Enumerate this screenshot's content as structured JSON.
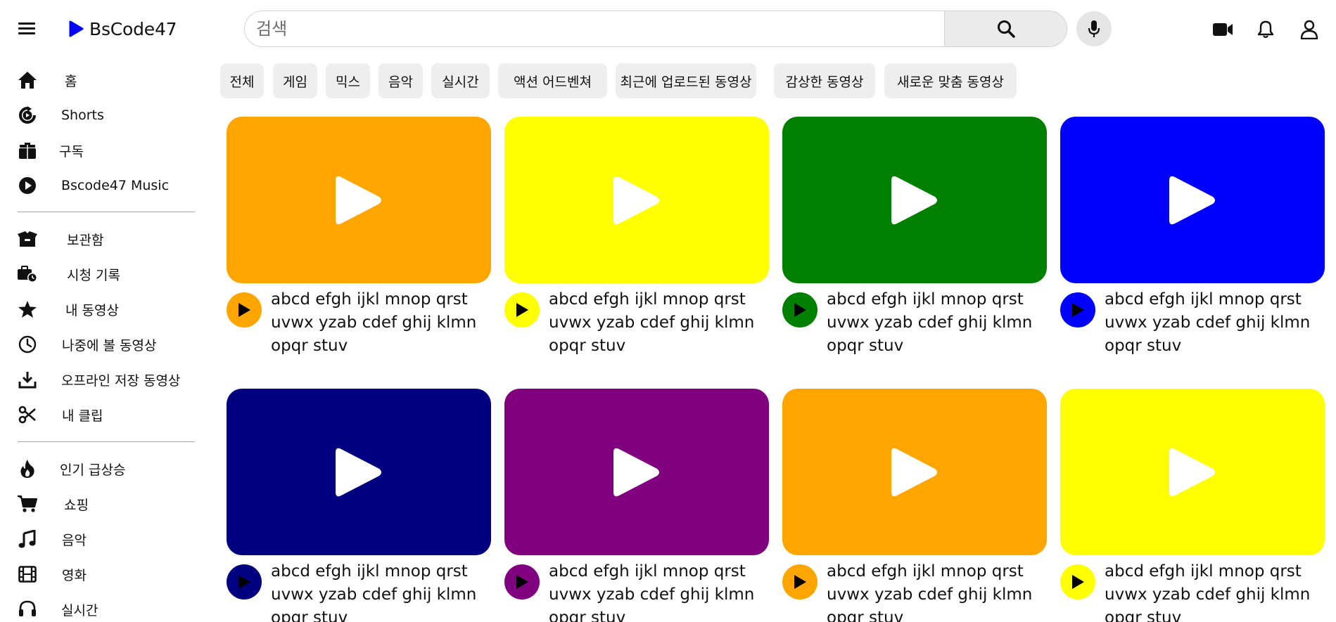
{
  "header": {
    "logo_text": "BsCode47",
    "search_placeholder": "검색",
    "icons": [
      "menu-icon",
      "play-logo-icon",
      "search-icon",
      "mic-icon",
      "video-camera-icon",
      "bell-icon",
      "user-icon"
    ]
  },
  "sidebar": {
    "items": [
      {
        "label": "홈",
        "icon": "home-icon"
      },
      {
        "label": "Shorts",
        "icon": "shorts-icon"
      },
      {
        "label": "구독",
        "icon": "subscriptions-icon"
      },
      {
        "label": "Bscode47 Music",
        "icon": "music-play-icon"
      },
      {
        "label": "보관함",
        "icon": "library-box-icon"
      },
      {
        "label": "시청 기록",
        "icon": "history-briefcase-icon"
      },
      {
        "label": "내 동영상",
        "icon": "star-icon"
      },
      {
        "label": "나중에 볼 동영상",
        "icon": "clock-icon"
      },
      {
        "label": "오프라인 저장 동영상",
        "icon": "download-icon"
      },
      {
        "label": "내 클립",
        "icon": "scissors-icon"
      },
      {
        "label": "인기 급상승",
        "icon": "fire-icon"
      },
      {
        "label": "쇼핑",
        "icon": "cart-icon"
      },
      {
        "label": "음악",
        "icon": "music-note-icon"
      },
      {
        "label": "영화",
        "icon": "film-icon"
      },
      {
        "label": "실시간",
        "icon": "headset-icon"
      }
    ]
  },
  "chips": [
    "전체",
    "게임",
    "믹스",
    "음악",
    "실시간",
    "액션 어드벤쳐",
    "최근에 업로드된 동영상",
    "감상한 동영상",
    "새로운 맞춤 동영상"
  ],
  "videos": [
    {
      "title": "abcd efgh ijkl mnop qrst uvwx yzab cdef ghij klmn opqr stuv",
      "color": "#ffa500"
    },
    {
      "title": "abcd efgh ijkl mnop qrst uvwx yzab cdef ghij klmn opqr stuv",
      "color": "#ffff00"
    },
    {
      "title": "abcd efgh ijkl mnop qrst uvwx yzab cdef ghij klmn opqr stuv",
      "color": "#008000"
    },
    {
      "title": "abcd efgh ijkl mnop qrst uvwx yzab cdef ghij klmn opqr stuv",
      "color": "#0000ff"
    },
    {
      "title": "abcd efgh ijkl mnop qrst uvwx yzab cdef ghij klmn opqr stuv",
      "color": "#000080"
    },
    {
      "title": "abcd efgh ijkl mnop qrst uvwx yzab cdef ghij klmn opqr stuv",
      "color": "#800080"
    },
    {
      "title": "abcd efgh ijkl mnop qrst uvwx yzab cdef ghij klmn opqr stuv",
      "color": "#ffa500"
    },
    {
      "title": "abcd efgh ijkl mnop qrst uvwx yzab cdef ghij klmn opqr stuv",
      "color": "#ffff00"
    }
  ],
  "colors": {
    "logo_accent": "#0000ff",
    "chip_bg": "#eeeeee"
  }
}
